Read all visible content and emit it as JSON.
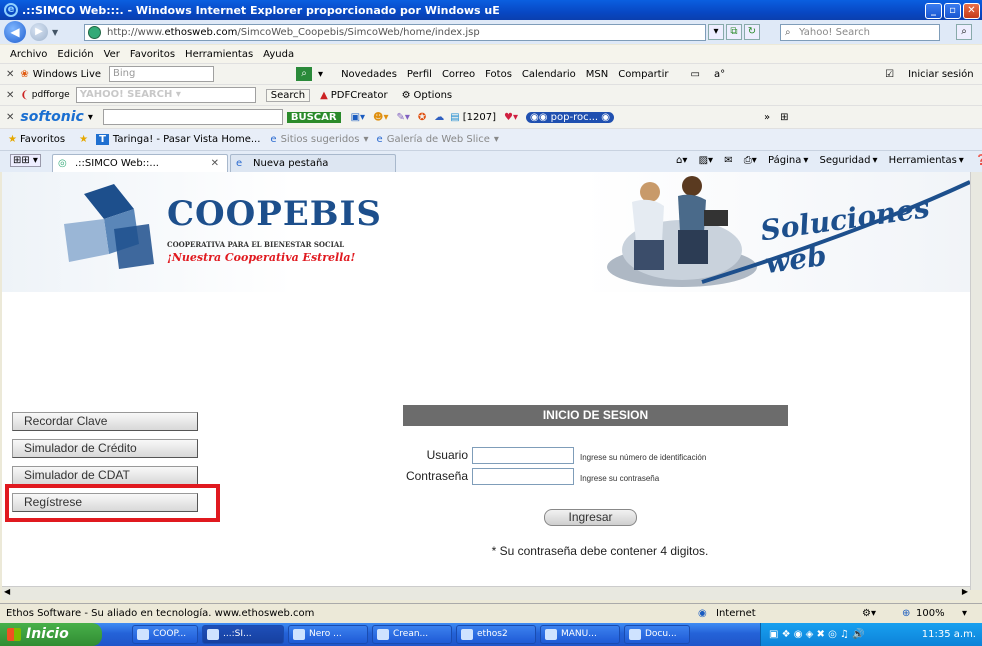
{
  "window": {
    "title": ".::SIMCO Web:::. - Windows Internet Explorer proporcionado por Windows uE"
  },
  "address": {
    "prefix": "http://www.",
    "domain": "ethosweb.com",
    "path": "/SimcoWeb_Coopebis/SimcoWeb/home/index.jsp"
  },
  "search_box": {
    "placeholder": "Yahoo! Search"
  },
  "menu": [
    "Archivo",
    "Edición",
    "Ver",
    "Favoritos",
    "Herramientas",
    "Ayuda"
  ],
  "live_toolbar": {
    "brand": "Windows Live",
    "placeholder": "Bing",
    "links": [
      "Novedades",
      "Perfil",
      "Correo",
      "Fotos",
      "Calendario",
      "MSN",
      "Compartir"
    ],
    "signin": "Iniciar sesión"
  },
  "yahoo_toolbar": {
    "brand": "pdfforge",
    "search_label": "Search",
    "pdf_label": "PDFCreator",
    "options_label": "Options"
  },
  "softonic_toolbar": {
    "brand": "softonic",
    "buscar_label": "BUSCAR",
    "count": "[1207]",
    "radio_label": "pop-roc..."
  },
  "favorites_bar": {
    "label": "Favoritos",
    "items": [
      "Taringa! - Pasar Vista Home...",
      "Sitios sugeridos",
      "Galería de Web Slice"
    ]
  },
  "tabs": [
    {
      "label": ".::SIMCO Web::..."
    },
    {
      "label": "Nueva pestaña"
    }
  ],
  "command_bar": [
    "Página",
    "Seguridad",
    "Herramientas"
  ],
  "page": {
    "logo_text": "COOPEBIS",
    "logo_subtitle": "COOPERATIVA PARA EL BIENESTAR SOCIAL",
    "logo_slogan": "¡Nuestra Cooperativa Estrella!",
    "banner_slogan": "Soluciones web",
    "side_buttons": [
      "Recordar Clave",
      "Simulador de Crédito",
      "Simulador de CDAT",
      "Regístrese"
    ],
    "login": {
      "header": "INICIO DE SESION",
      "user_label": "Usuario",
      "user_hint": "Ingrese su número de identificación",
      "pass_label": "Contraseña",
      "pass_hint": "Ingrese su contraseña",
      "submit_label": "Ingresar",
      "note": "* Su contraseña debe contener 4 digitos."
    }
  },
  "statusbar": {
    "text": "Ethos Software - Su aliado en tecnología. www.ethosweb.com",
    "zone": "Internet",
    "zoom": "100%"
  },
  "taskbar": {
    "start": "Inicio",
    "tasks": [
      "COOP...",
      "...:SI...",
      "Nero ...",
      "Crean...",
      "ethos2",
      "MANU...",
      "Docu..."
    ],
    "time": "11:35 a.m."
  }
}
